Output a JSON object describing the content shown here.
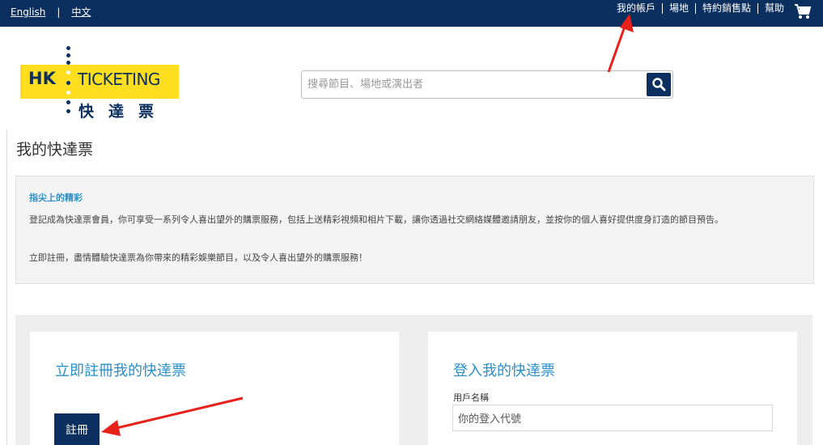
{
  "topbar": {
    "lang_en": "English",
    "lang_sep": "|",
    "lang_zh": "中文",
    "nav": [
      "我的帳戶",
      "場地",
      "特約銷售點",
      "幫助"
    ],
    "cart_icon": "cart-icon"
  },
  "logo": {
    "hk": "HK",
    "ticketing": "TICKETING",
    "zh": "快達票"
  },
  "search": {
    "placeholder": "搜尋節目、場地或演出者",
    "icon": "search-icon"
  },
  "page": {
    "title": "我的快達票"
  },
  "info": {
    "heading": "指尖上的精彩",
    "para1": "登記成為快達票會員，你可享受一系列令人喜出望外的購票服務，包括上送精彩視頻和相片下載，讓你透過社交網絡媒體邀請朋友，並按你的個人喜好提供度身訂造的節目預告。",
    "para2": "立即註冊，盡情體驗快達票為你帶來的精彩娛樂節目，以及令人喜出望外的購票服務！"
  },
  "register": {
    "heading": "立即註冊我的快達票",
    "button": "註冊"
  },
  "login": {
    "heading": "登入我的快達票",
    "username_label": "用戶名稱",
    "username_value": "你的登入代號"
  },
  "colors": {
    "navy": "#0b2f5e",
    "logo_yellow": "#ffdd1f",
    "accent_blue": "#2a8fc7",
    "annotation_red": "#e8211b"
  }
}
